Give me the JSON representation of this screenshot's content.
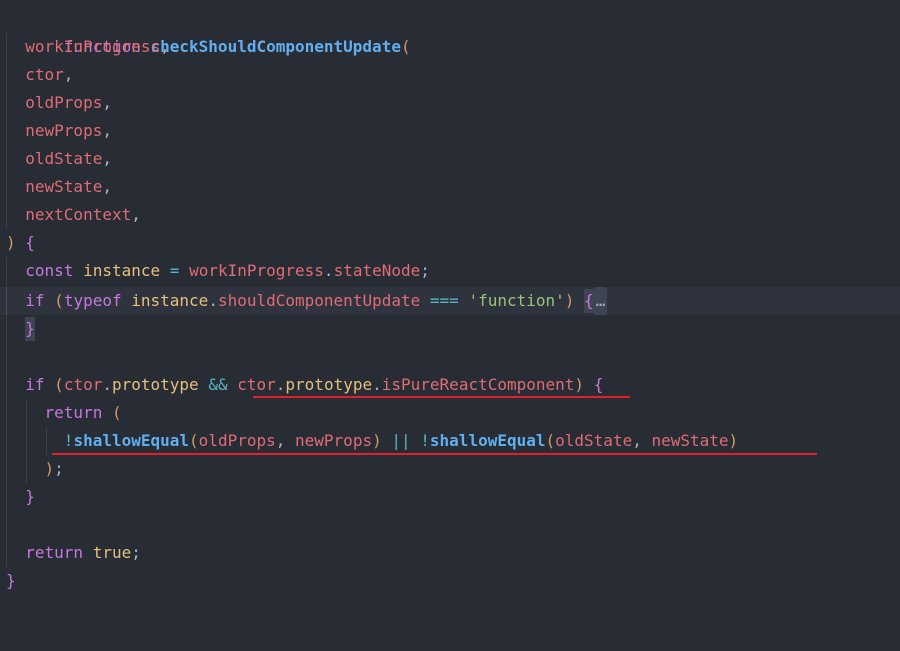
{
  "code": {
    "line01": {
      "kw": "function",
      "fn": "checkShouldComponentUpdate",
      "paren": "("
    },
    "line02": {
      "param": "workInProgress",
      "punc": ","
    },
    "line03": {
      "param": "ctor",
      "punc": ","
    },
    "line04": {
      "param": "oldProps",
      "punc": ","
    },
    "line05": {
      "param": "newProps",
      "punc": ","
    },
    "line06": {
      "param": "oldState",
      "punc": ","
    },
    "line07": {
      "param": "newState",
      "punc": ","
    },
    "line08": {
      "param": "nextContext",
      "punc": ","
    },
    "line09": {
      "paren": ")",
      "brace": "{"
    },
    "line10": {
      "kw": "const",
      "var": "instance",
      "op": "=",
      "obj": "workInProgress",
      "dot": ".",
      "prop": "stateNode",
      "semi": ";"
    },
    "line11": {
      "kw": "if",
      "paren_open": "(",
      "typeof": "typeof",
      "var": "instance",
      "dot": ".",
      "prop": "shouldComponentUpdate",
      "op": "===",
      "str": "'function'",
      "paren_close": ")",
      "brace": "{",
      "ellipsis": "…"
    },
    "line12": {
      "brace": "}"
    },
    "line14": {
      "kw": "if",
      "paren_open": "(",
      "obj1": "ctor",
      "dot1": ".",
      "prop1": "prototype",
      "op": "&&",
      "obj2": "ctor",
      "dot2": ".",
      "prop2": "prototype",
      "dot3": ".",
      "prop3": "isPureReactComponent",
      "paren_close": ")",
      "brace": "{"
    },
    "line15": {
      "kw": "return",
      "paren": "("
    },
    "line16": {
      "not1": "!",
      "fn1": "shallowEqual",
      "paren1": "(",
      "arg1": "oldProps",
      "comma1": ",",
      "arg2": "newProps",
      "paren2": ")",
      "op": "||",
      "not2": "!",
      "fn2": "shallowEqual",
      "paren3": "(",
      "arg3": "oldState",
      "comma2": ",",
      "arg4": "newState",
      "paren4": ")"
    },
    "line17": {
      "paren": ")",
      "semi": ";"
    },
    "line18": {
      "brace": "}"
    },
    "line20": {
      "kw": "return",
      "val": "true",
      "semi": ";"
    },
    "line21": {
      "brace": "}"
    }
  },
  "colors": {
    "background": "#282c34",
    "keyword": "#c678dd",
    "function": "#61afef",
    "parameter": "#e06c75",
    "variable": "#e5c07b",
    "string": "#98c379",
    "operator": "#56b6c2",
    "underline": "#e0202a"
  }
}
